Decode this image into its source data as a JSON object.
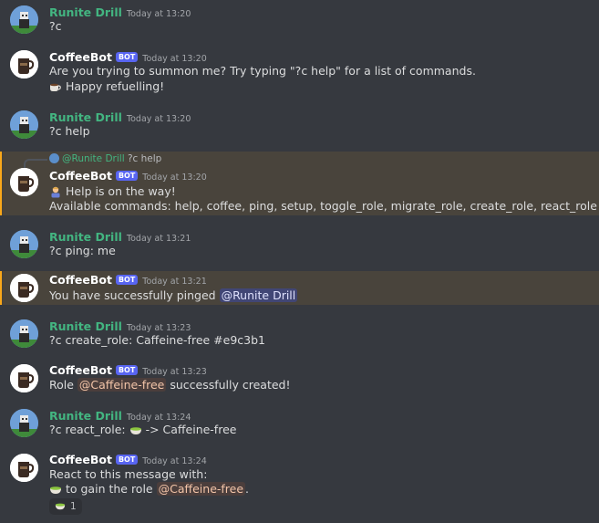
{
  "messages": [
    {
      "author": "Runite Drill",
      "time": "Today at 13:20",
      "text": "?c"
    },
    {
      "author": "CoffeeBot",
      "tag": "BOT",
      "time": "Today at 13:20",
      "line1": "Are you trying to summon me? Try typing \"?c help\" for a list of commands.",
      "line2": "Happy refuelling!"
    },
    {
      "author": "Runite Drill",
      "time": "Today at 13:20",
      "text": "?c help"
    },
    {
      "reply_author": "@Runite Drill",
      "reply_text": "?c help",
      "author": "CoffeeBot",
      "tag": "BOT",
      "time": "Today at 13:20",
      "line1": "Help is on the way!",
      "line2": "Available commands: help, coffee, ping, setup, toggle_role, migrate_role, create_role, react_role"
    },
    {
      "author": "Runite Drill",
      "time": "Today at 13:21",
      "text": "?c ping: me"
    },
    {
      "author": "CoffeeBot",
      "tag": "BOT",
      "time": "Today at 13:21",
      "text_pre": "You have successfully pinged ",
      "mention": "@Runite Drill"
    },
    {
      "author": "Runite Drill",
      "time": "Today at 13:23",
      "text": "?c create_role: Caffeine-free #e9c3b1"
    },
    {
      "author": "CoffeeBot",
      "tag": "BOT",
      "time": "Today at 13:23",
      "text_pre": "Role ",
      "mention": "@Caffeine-free",
      "text_post": " successfully created!"
    },
    {
      "author": "Runite Drill",
      "time": "Today at 13:24",
      "text_pre": "?c react_role: ",
      "text_post": " -> Caffeine-free"
    },
    {
      "author": "CoffeeBot",
      "tag": "BOT",
      "time": "Today at 13:24",
      "line1": "React to this message with:",
      "line2_pre": " to gain the role ",
      "mention": "@Caffeine-free",
      "line2_post": ".",
      "reaction_count": "1"
    }
  ],
  "colors": {
    "background": "#36393f",
    "username_user": "#43b581",
    "highlight": "#49443c",
    "highlight_bar": "#faa81a",
    "bot_tag": "#5865f2",
    "role_mention": "#f2c4a8"
  },
  "icons": {
    "user_avatar": "pixel-character-avatar",
    "bot_avatar": "coffee-cup-avatar",
    "refuel": "coffee-emoji",
    "help": "helper-person-emoji",
    "matcha": "matcha-bowl-emoji"
  }
}
